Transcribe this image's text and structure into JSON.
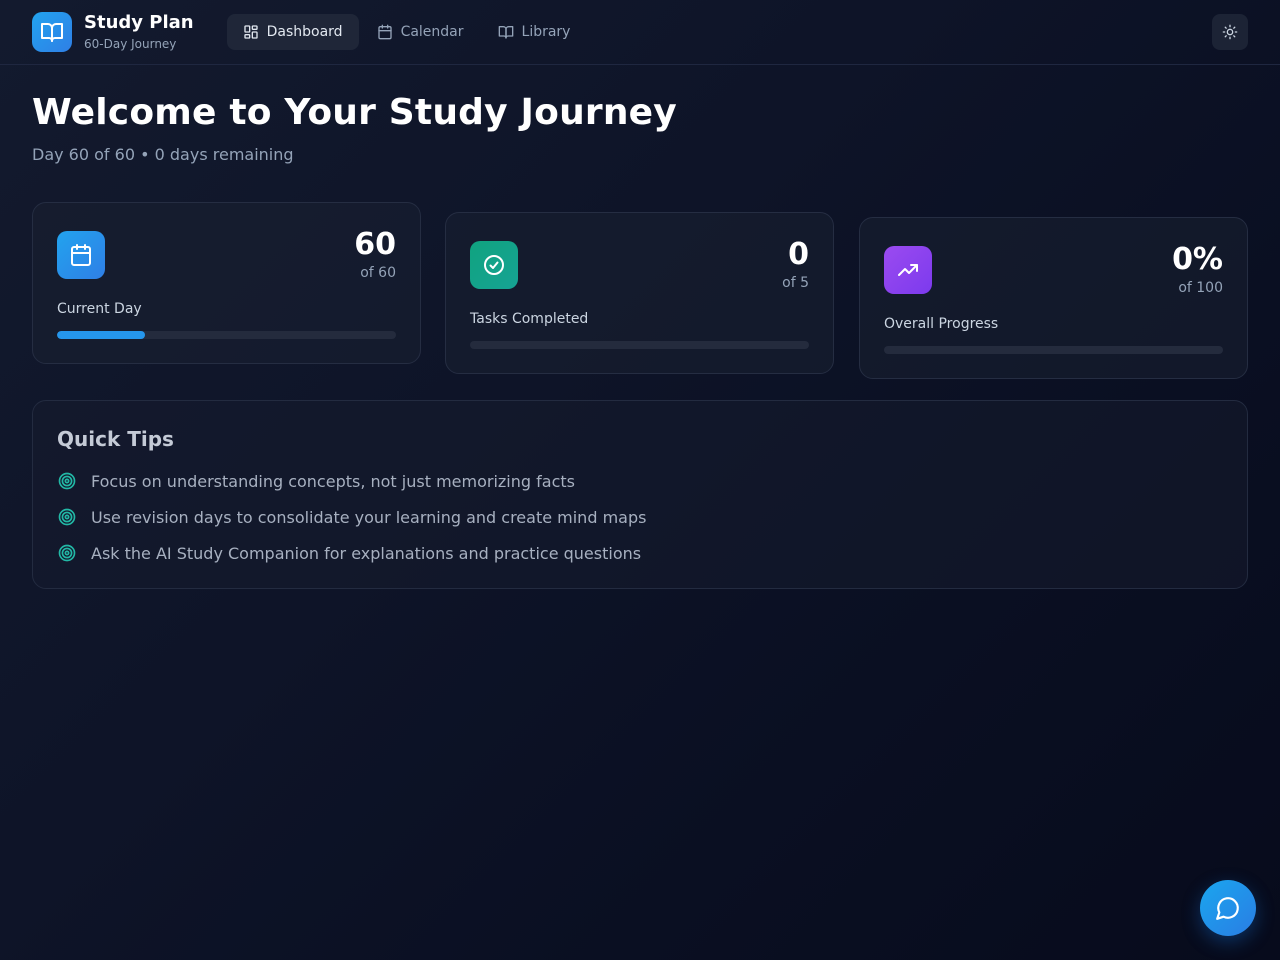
{
  "header": {
    "brand_title": "Study Plan",
    "brand_subtitle": "60-Day Journey",
    "logo_icon": "book-open-icon",
    "nav": [
      {
        "label": "Dashboard",
        "icon": "grid-icon",
        "active": true
      },
      {
        "label": "Calendar",
        "icon": "calendar-icon",
        "active": false
      },
      {
        "label": "Library",
        "icon": "book-icon",
        "active": false
      }
    ],
    "theme_icon": "sun-icon"
  },
  "hero": {
    "title": "Welcome to Your Study Journey",
    "day_text": "Day 60 of 60",
    "separator": "•",
    "remaining_text": "0 days remaining"
  },
  "stats": [
    {
      "value": "60",
      "of": "of 60",
      "label": "Current Day",
      "icon": "calendar-icon",
      "color": "#2596ec",
      "progress": 0.26
    },
    {
      "value": "0",
      "of": "of 5",
      "label": "Tasks Completed",
      "icon": "check-circle-icon",
      "color": "#14a085",
      "progress": 0
    },
    {
      "value": "0%",
      "of": "of 100",
      "label": "Overall Progress",
      "icon": "trending-up-icon",
      "color": "#8b45ec",
      "progress": 0
    }
  ],
  "tips": {
    "title": "Quick Tips",
    "icon": "target-icon",
    "items": [
      "Focus on understanding concepts, not just memorizing facts",
      "Use revision days to consolidate your learning and create mind maps",
      "Ask the AI Study Companion for explanations and practice questions"
    ]
  },
  "chat": {
    "icon": "message-circle-icon"
  },
  "colors": {
    "accent": "#22a3ee",
    "tip_icon": "#22b8a6",
    "background": "#0e1428"
  }
}
